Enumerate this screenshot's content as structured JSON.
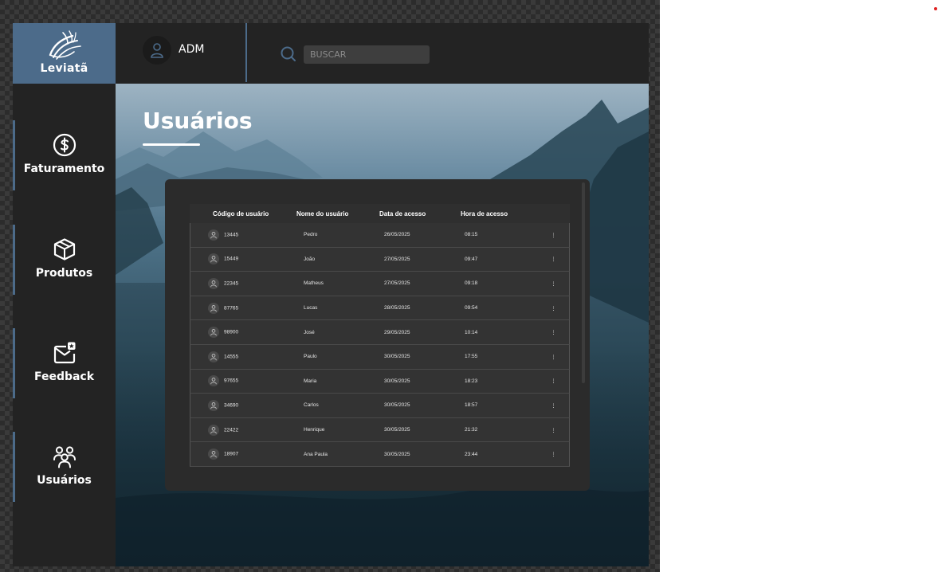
{
  "brand": {
    "name": "Leviatã"
  },
  "header": {
    "user_name": "ADM",
    "search_placeholder": "BUSCAR"
  },
  "sidebar": {
    "items": [
      {
        "label": "Faturamento",
        "icon": "dollar-circle-icon"
      },
      {
        "label": "Produtos",
        "icon": "box-icon"
      },
      {
        "label": "Feedback",
        "icon": "feedback-mail-icon"
      },
      {
        "label": "Usuários",
        "icon": "users-icon"
      }
    ]
  },
  "main": {
    "title": "Usuários",
    "table": {
      "headers": [
        "Código de usuário",
        "Nome do usuário",
        "Data de acesso",
        "Hora de acesso"
      ],
      "rows": [
        [
          "13445",
          "Pedro",
          "26/05/2025",
          "08:15"
        ],
        [
          "15449",
          "João",
          "27/05/2025",
          "09:47"
        ],
        [
          "22345",
          "Matheus",
          "27/05/2025",
          "09:18"
        ],
        [
          "87765",
          "Lucas",
          "28/05/2025",
          "09:54"
        ],
        [
          "98900",
          "José",
          "29/05/2025",
          "10:14"
        ],
        [
          "14555",
          "Paulo",
          "30/05/2025",
          "17:55"
        ],
        [
          "97655",
          "Maria",
          "30/05/2025",
          "18:23"
        ],
        [
          "34690",
          "Carlos",
          "30/05/2025",
          "18:57"
        ],
        [
          "22422",
          "Henrique",
          "30/05/2025",
          "21:32"
        ],
        [
          "18907",
          "Ana Paula",
          "30/05/2025",
          "23:44"
        ]
      ]
    }
  },
  "colors": {
    "accent": "#4c6b8a",
    "panel": "#232323",
    "card": "#2b2b2b"
  }
}
